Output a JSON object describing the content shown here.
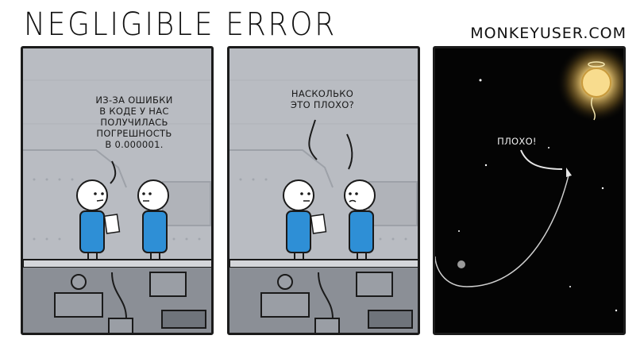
{
  "comic": {
    "title": "NEGLIGIBLE ERROR",
    "site": "MONKEYUSER.COM"
  },
  "panels": [
    {
      "speech": "ИЗ-ЗА ОШИБКИ\nВ КОДЕ У НАС\nПОЛУЧИЛАСЬ\nПОГРЕШНОСТЬ\nВ 0.000001."
    },
    {
      "speech": "НАСКОЛЬКО\nЭТО ПЛОХО?"
    },
    {
      "speech": "ПЛОХО!"
    }
  ],
  "colors": {
    "wall": "#b9bcc2",
    "wall_shade": "#a5a9b0",
    "shirt": "#2e8fd6",
    "machinery": "#8b8f96",
    "sky": "#040404",
    "sun": "#f6d27a"
  }
}
